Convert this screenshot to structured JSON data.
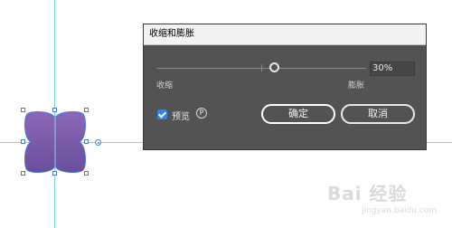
{
  "dialog": {
    "title": "收缩和膨胀",
    "slider": {
      "left_label": "收缩",
      "right_label": "膨胀",
      "value": "30%"
    },
    "preview": {
      "label": "预览",
      "shortcut": "P",
      "checked": true
    },
    "ok_label": "确定",
    "cancel_label": "取消"
  },
  "canvas": {
    "shape_fill_top": "#8a68b8",
    "shape_fill_bottom": "#6a4e9c",
    "guide_color": "#7fd3f5",
    "handle_color": "#3d7cf0"
  },
  "watermark": {
    "logo_text": "Bai 经验",
    "url": "jingyan.baidu.com"
  }
}
